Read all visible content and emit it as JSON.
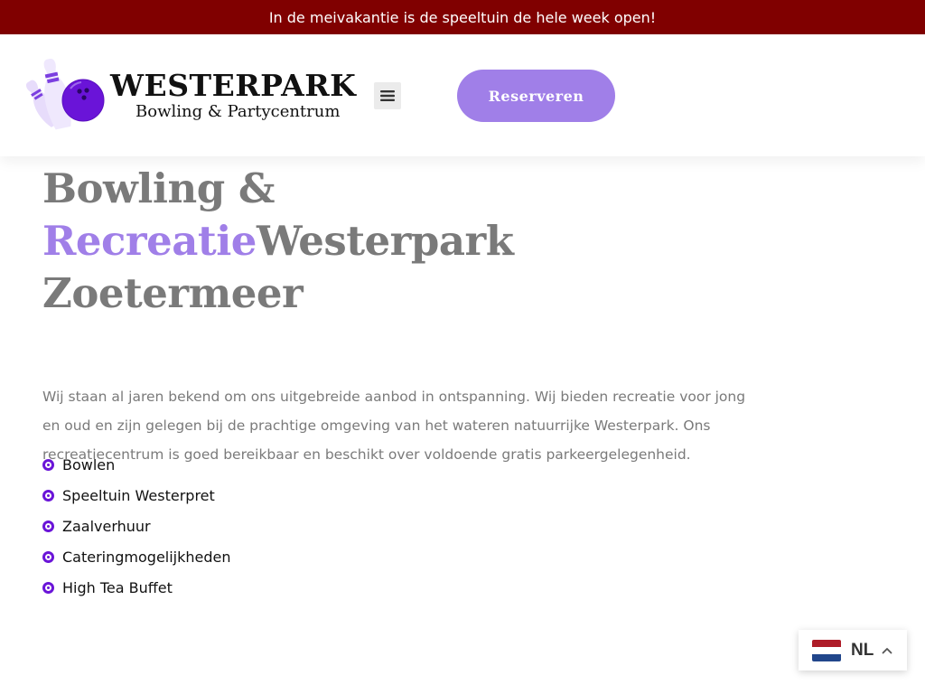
{
  "announcement": {
    "text": "In de meivakantie is de speeltuin de hele week open!",
    "background": "#800000"
  },
  "header": {
    "logo": {
      "title": "WESTERPARK",
      "subtitle": "Bowling & Partycentrum"
    },
    "menu_icon": "hamburger-menu-icon",
    "reserve_label": "Reserveren"
  },
  "hero": {
    "title_part1": "Bowling & ",
    "title_accent": "Recreatie",
    "title_part2": "Westerpark Zoetermeer",
    "accent_color": "#a07fe8"
  },
  "intro": {
    "text": "Wij staan al jaren bekend om ons uitgebreide aanbod in ontspanning. Wij bieden recreatie voor jong en oud en zijn gelegen bij de prachtige omgeving van het wateren natuurrijke Westerpark. Ons recreatiecentrum is goed bereikbaar en beschikt over voldoende gratis parkeergelegenheid."
  },
  "features": [
    {
      "label": "Bowlen"
    },
    {
      "label": "Speeltuin Westerpret"
    },
    {
      "label": "Zaalverhuur"
    },
    {
      "label": "Cateringmogelijkheden"
    },
    {
      "label": "High Tea Buffet"
    }
  ],
  "language_switcher": {
    "code": "NL",
    "flag": "netherlands-flag-icon",
    "colors": [
      "#ae1c28",
      "#ffffff",
      "#21468b"
    ]
  }
}
